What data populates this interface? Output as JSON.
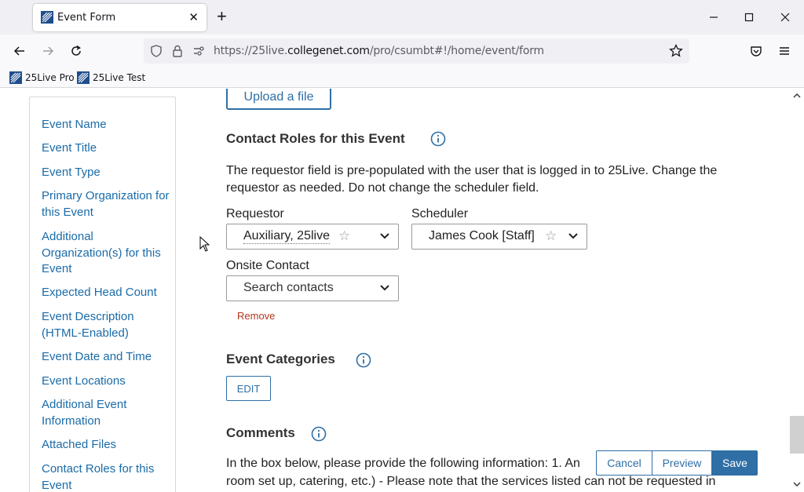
{
  "browser": {
    "tab_title": "Event Form",
    "url_prefix": "https://25live.",
    "url_host": "collegenet.com",
    "url_path": "/pro/csumbt#!/home/event/form",
    "bookmarks": [
      "25Live Pro",
      "25Live Test"
    ]
  },
  "sidebar": {
    "items": [
      "Event Name",
      "Event Title",
      "Event Type",
      "Primary Organization for this Event",
      "Additional Organization(s) for this Event",
      "Expected Head Count",
      "Event Description (HTML-Enabled)",
      "Event Date and Time",
      "Event Locations",
      "Additional Event Information",
      "Attached Files",
      "Contact Roles for this Event"
    ]
  },
  "main": {
    "upload_label": "Upload a file",
    "contact_roles_title": "Contact Roles for this Event",
    "contact_roles_desc": "The requestor field is pre-populated with the user that is logged in to 25Live. Change the requestor as needed. Do not change the scheduler field.",
    "requestor_label": "Requestor",
    "requestor_value": "Auxiliary, 25live",
    "scheduler_label": "Scheduler",
    "scheduler_value": "James Cook [Staff]",
    "onsite_label": "Onsite Contact",
    "onsite_placeholder": "Search contacts",
    "remove_label": "Remove",
    "categories_title": "Event Categories",
    "edit_label": "EDIT",
    "comments_title": "Comments",
    "comments_line1": "In the box below, please provide the following information: 1. An",
    "comments_line2": "room set up, catering, etc.) - Please note that the services listed can not be requested in"
  },
  "actions": {
    "cancel": "Cancel",
    "preview": "Preview",
    "save": "Save"
  },
  "colors": {
    "link": "#1a6ba8",
    "accent": "#2f6fa6",
    "danger": "#b5361b"
  }
}
